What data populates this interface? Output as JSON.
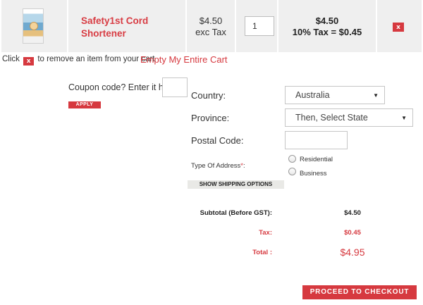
{
  "cart": {
    "item": {
      "name": "Safety1st Cord Shortener",
      "image_alt": "product-thumbnail",
      "unit_price": "$4.50",
      "unit_price_note": "exc Tax",
      "quantity": "1",
      "line_total": "$4.50",
      "line_tax": "10% Tax = $0.45",
      "remove_label": "x"
    },
    "remove_hint_prefix": "Click",
    "remove_hint_icon": "x",
    "remove_hint_suffix": "to remove an item from your cart",
    "empty_cart_label": "Empty My Entire Cart"
  },
  "coupon": {
    "label": "Coupon code? Enter it here:",
    "value": "",
    "apply_label": "APPLY"
  },
  "shipping": {
    "country_label": "Country:",
    "country_value": "Australia",
    "province_label": "Province:",
    "province_value": "Then, Select State",
    "postal_label": "Postal Code:",
    "postal_value": "",
    "address_type_label": "Type Of Address",
    "address_type_required": "*",
    "address_type_colon": ":",
    "address_options": [
      "Residential",
      "Business"
    ],
    "show_options_label": "SHOW SHIPPING OPTIONS"
  },
  "totals": {
    "subtotal_label": "Subtotal (Before GST):",
    "subtotal_value": "$4.50",
    "tax_label": "Tax:",
    "tax_value": "$0.45",
    "total_label": "Total :",
    "total_value": "$4.95"
  },
  "checkout_label": "PROCEED TO CHECKOUT",
  "colors": {
    "accent": "#d6393f",
    "cell_background": "#efefef"
  },
  "icons": {
    "dropdown": "chevron-down-icon",
    "remove": "close-icon"
  }
}
